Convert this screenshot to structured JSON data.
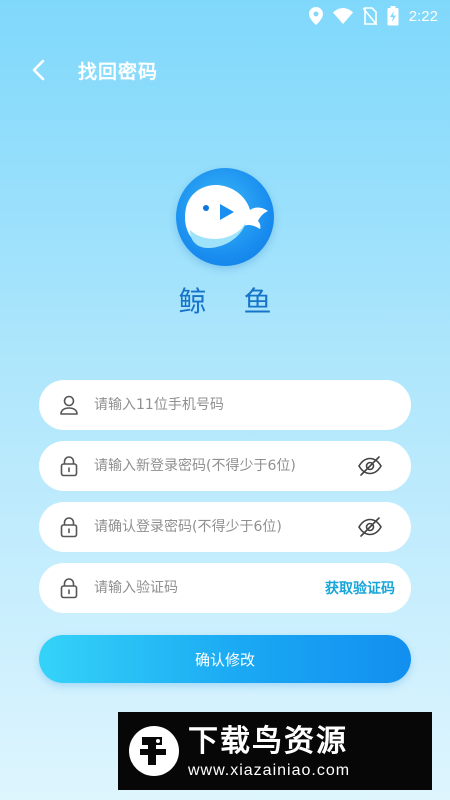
{
  "status_bar": {
    "time": "2:22",
    "icons": [
      "location-icon",
      "wifi-icon",
      "no-sim-icon",
      "battery-charging-icon"
    ]
  },
  "header": {
    "title": "找回密码",
    "back_icon": "chevron-left-icon"
  },
  "logo": {
    "app_name": "鲸 鱼",
    "icon": "whale-logo"
  },
  "form": {
    "phone": {
      "placeholder": "请输入11位手机号码",
      "value": "",
      "icon": "user-icon"
    },
    "new_password": {
      "placeholder": "请输入新登录密码(不得少于6位)",
      "value": "",
      "icon": "lock-icon",
      "toggle_icon": "eye-off-icon"
    },
    "confirm_password": {
      "placeholder": "请确认登录密码(不得少于6位)",
      "value": "",
      "icon": "lock-icon",
      "toggle_icon": "eye-off-icon"
    },
    "verify_code": {
      "placeholder": "请输入验证码",
      "value": "",
      "icon": "lock-icon",
      "button_label": "获取验证码"
    },
    "submit_label": "确认修改"
  },
  "watermark": {
    "title": "下载鸟资源",
    "url": "www.xiazainiao.com"
  },
  "colors": {
    "accent": "#18a6da",
    "button_start": "#35d3f8",
    "button_end": "#128ff0",
    "logo_blue": "#1774c8"
  }
}
